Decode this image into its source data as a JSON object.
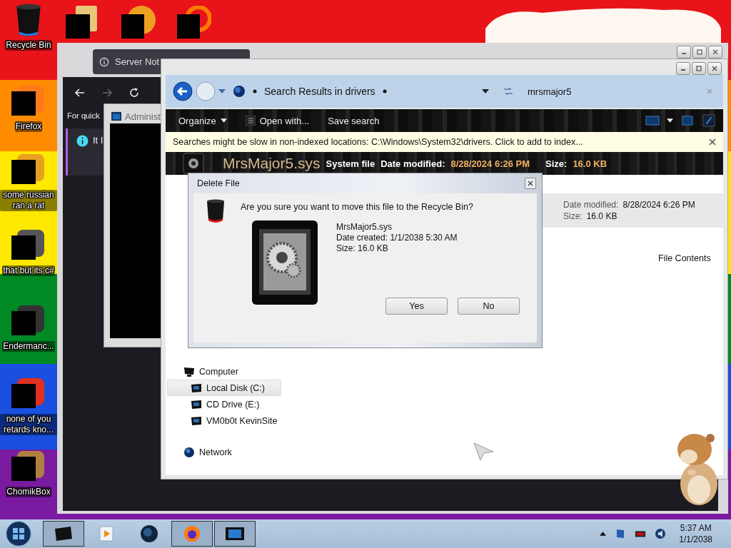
{
  "desktop_icons": [
    {
      "label": "Recycle Bin"
    },
    {
      "label": "Firefox"
    },
    {
      "label": "some russian ran a rat"
    },
    {
      "label": "that but its c#"
    },
    {
      "label": "Endermanc..."
    },
    {
      "label": "none of you retards kno..."
    },
    {
      "label": "ChomikBox"
    }
  ],
  "browser": {
    "tab_title": "Server Not",
    "hint": "For quick",
    "notice": "It I"
  },
  "console": {
    "title": "Administ"
  },
  "explorer": {
    "address": "Search Results in drivers",
    "search": "mrsmajor5",
    "toolbar": [
      {
        "label": "Organize",
        "kind": "dropdown"
      },
      {
        "label": "Open with...",
        "kind": "icon"
      },
      {
        "label": "Save search",
        "kind": "plain"
      }
    ],
    "info_bar": "Searches might be slow in non-indexed locations: C:\\Windows\\System32\\drivers. Click to add to index...",
    "details": {
      "name": "MrsMajor5.sys",
      "type": "System file",
      "modified_label": "Date modified:",
      "modified": "8/28/2024 6:26 PM",
      "size_label": "Size:",
      "size": "16.0 KB"
    },
    "preview": {
      "modified_label": "Date modified:",
      "modified": "8/28/2024 6:26 PM",
      "size_label": "Size:",
      "size": "16.0 KB",
      "contents": "File Contents"
    },
    "nav": [
      {
        "label": "Computer",
        "kind": "computer",
        "selected": false,
        "children": [
          {
            "label": "Local Disk (C:)",
            "selected": true
          },
          {
            "label": "CD Drive (E:)",
            "selected": false
          },
          {
            "label": "VM0b0t KevinSite",
            "selected": false
          }
        ]
      },
      {
        "label": "Network",
        "kind": "network",
        "selected": false
      }
    ]
  },
  "dialog": {
    "title": "Delete File",
    "question": "Are you sure you want to move this file to the Recycle Bin?",
    "file_name": "MrsMajor5.sys",
    "created": "Date created: 1/1/2038 5:30 AM",
    "size": "Size: 16.0 KB",
    "buttons": [
      "Yes",
      "No"
    ]
  },
  "taskbar": {
    "items": [
      {
        "running": true
      },
      {
        "running": false
      },
      {
        "running": false
      },
      {
        "running": true
      },
      {
        "running": true
      }
    ],
    "time": "5:37 AM",
    "date": "1/1/2038"
  }
}
